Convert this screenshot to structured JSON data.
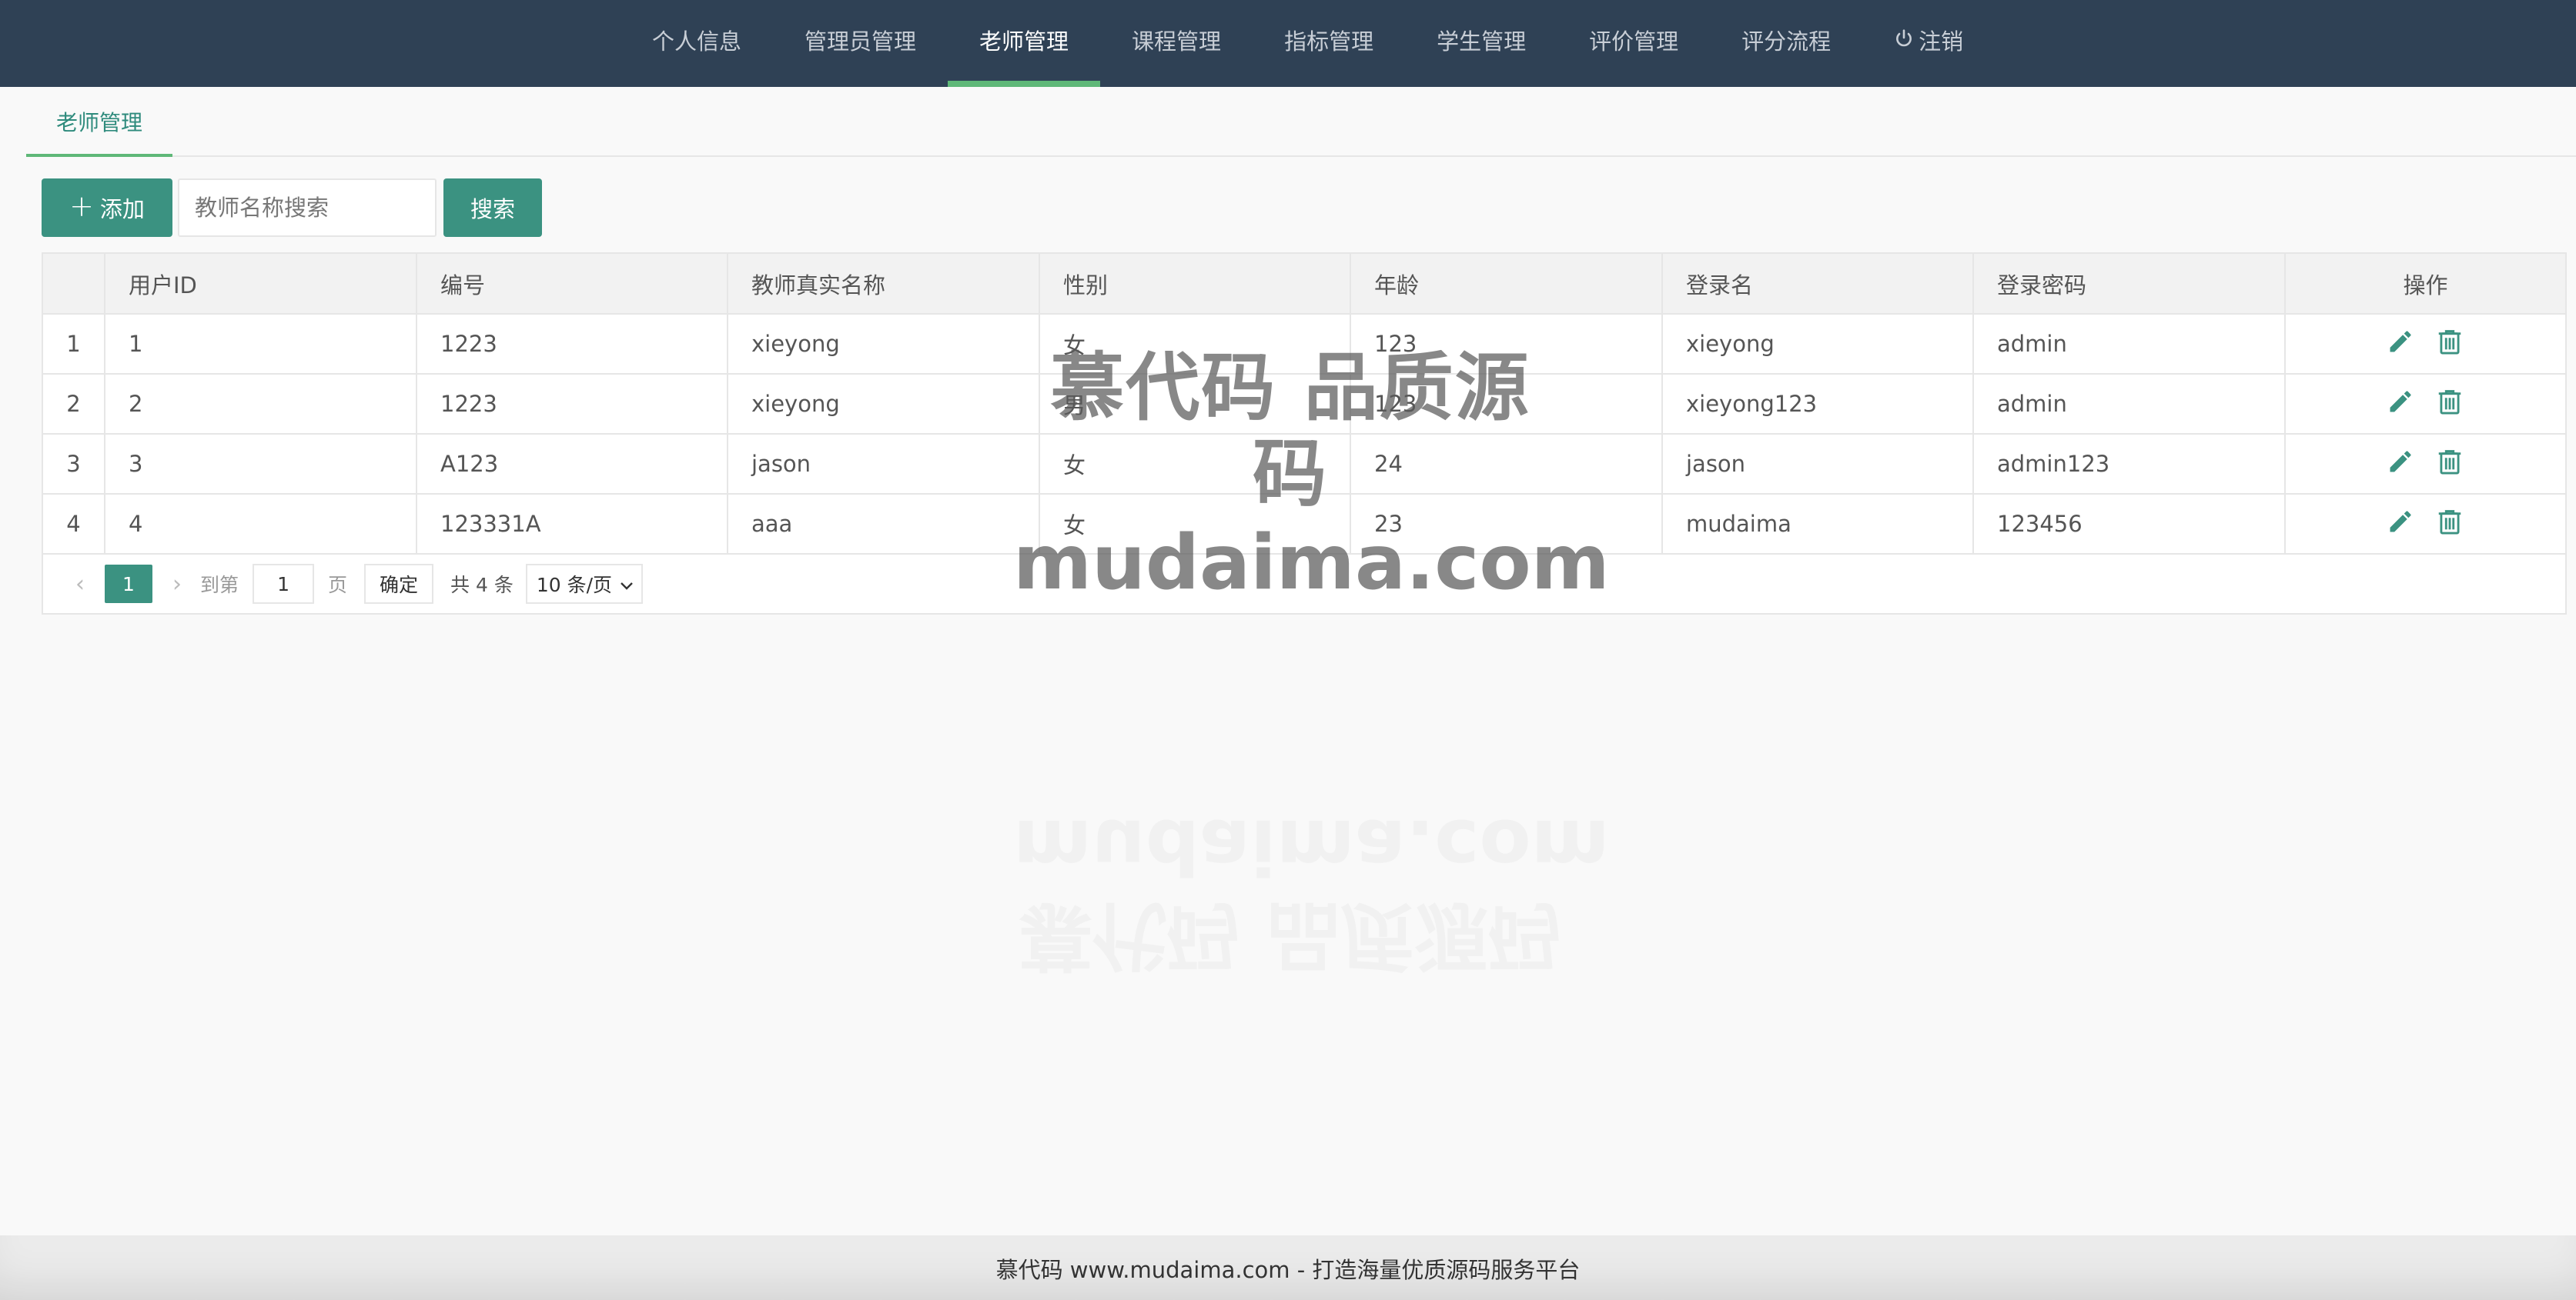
{
  "nav": {
    "items": [
      {
        "label": "个人信息",
        "active": false
      },
      {
        "label": "管理员管理",
        "active": false
      },
      {
        "label": "老师管理",
        "active": true
      },
      {
        "label": "课程管理",
        "active": false
      },
      {
        "label": "指标管理",
        "active": false
      },
      {
        "label": "学生管理",
        "active": false
      },
      {
        "label": "评价管理",
        "active": false
      },
      {
        "label": "评分流程",
        "active": false
      }
    ],
    "logout_label": "注销",
    "logout_icon": "power-icon"
  },
  "tab": {
    "label": "老师管理"
  },
  "toolbar": {
    "add_label": "添加",
    "add_icon": "plus-icon",
    "search_placeholder": "教师名称搜索",
    "search_value": "",
    "search_label": "搜索"
  },
  "table": {
    "columns": [
      "",
      "用户ID",
      "编号",
      "教师真实名称",
      "性别",
      "年龄",
      "登录名",
      "登录密码",
      "操作"
    ],
    "rows": [
      {
        "index": "1",
        "user_id": "1",
        "code": "1223",
        "name": "xieyong",
        "gender": "女",
        "age": "123",
        "login": "xieyong",
        "password": "admin"
      },
      {
        "index": "2",
        "user_id": "2",
        "code": "1223",
        "name": "xieyong",
        "gender": "男",
        "age": "123",
        "login": "xieyong123",
        "password": "admin"
      },
      {
        "index": "3",
        "user_id": "3",
        "code": "A123",
        "name": "jason",
        "gender": "女",
        "age": "24",
        "login": "jason",
        "password": "admin123"
      },
      {
        "index": "4",
        "user_id": "4",
        "code": "123331A",
        "name": "aaa",
        "gender": "女",
        "age": "23",
        "login": "mudaima",
        "password": "123456"
      }
    ],
    "row_actions": [
      "edit-icon",
      "delete-icon"
    ]
  },
  "pager": {
    "prev": "‹",
    "current_page": "1",
    "next": "›",
    "goto_label": "到第",
    "goto_value": "1",
    "page_unit": "页",
    "confirm_label": "确定",
    "total_text": "共 4 条",
    "page_size": "10 条/页"
  },
  "watermark": {
    "line1": "慕代码 品质源码",
    "line2": "mudaima.com"
  },
  "footer": {
    "text": "慕代码 www.mudaima.com - 打造海量优质源码服务平台"
  },
  "colors": {
    "nav_bg": "#2f4155",
    "accent": "#3b9281",
    "active_underline": "#5fb878"
  }
}
